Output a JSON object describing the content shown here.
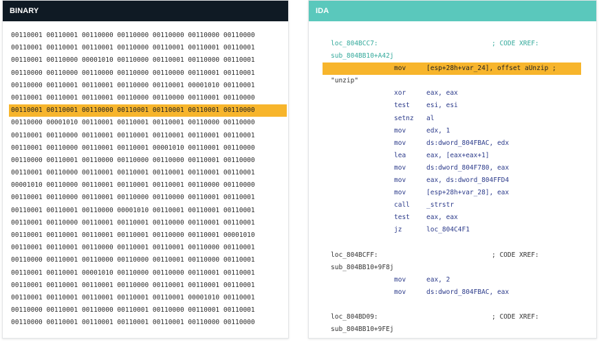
{
  "binary": {
    "title": "BINARY",
    "rows": [
      "00110001 00110001 00110000 00110000 00110000 00110000 00110000",
      "00110001 00110001 00110001 00110000 00110001 00110001 00110001",
      "00110001 00110000 00001010 00110000 00110001 00110000 00110001",
      "00110000 00110000 00110000 00110000 00110000 00110001 00110001",
      "00110000 00110001 00110001 00110000 00110001 00001010 00110001",
      "00110001 00110001 00110001 00110000 00110000 00110001 00110000",
      "00110001 00110001 00110000 00110001 00110001 00110001 00110000",
      "00110000 00001010 00110001 00110001 00110001 00110000 00110000",
      "00110001 00110000 00110001 00110001 00110001 00110001 00110001",
      "00110001 00110000 00110001 00110001 00001010 00110001 00110000",
      "00110000 00110001 00110000 00110000 00110000 00110001 00110000",
      "00110001 00110000 00110001 00110001 00110001 00110001 00110001",
      "00001010 00110000 00110001 00110001 00110001 00110000 00110000",
      "00110001 00110000 00110001 00110000 00110000 00110001 00110001",
      "00110001 00110001 00110000 00001010 00110001 00110001 00110001",
      "00110001 00110000 00110001 00110001 00110000 00110001 00110001",
      "00110001 00110001 00110001 00110001 00110000 00110001 00001010",
      "00110001 00110001 00110000 00110001 00110001 00110000 00110001",
      "00110000 00110001 00110000 00110000 00110001 00110000 00110001",
      "00110001 00110001 00001010 00110000 00110000 00110001 00110001",
      "00110001 00110001 00110001 00110000 00110001 00110001 00110001",
      "00110001 00110001 00110001 00110001 00110001 00001010 00110001",
      "00110000 00110001 00110000 00110001 00110000 00110001 00110001",
      "00110000 00110001 00110001 00110001 00110001 00110000 00110000"
    ],
    "highlighted_row": 6
  },
  "ida": {
    "title": "IDA",
    "lines": [
      {
        "label": "loc_804BCC7:",
        "xref": "; CODE XREF:"
      },
      {
        "label": "sub_804BB10+A42j"
      },
      {
        "mnemonic": "mov",
        "operand": "[esp+28h+var_24], offset aUnzip ;",
        "highlight": true
      },
      {
        "string": "\"unzip\""
      },
      {
        "mnemonic": "xor",
        "operand": "eax, eax"
      },
      {
        "mnemonic": "test",
        "operand": "esi, esi"
      },
      {
        "mnemonic": "setnz",
        "operand": "al"
      },
      {
        "mnemonic": "mov",
        "operand": "edx, 1"
      },
      {
        "mnemonic": "mov",
        "operand": "ds:dword_804FBAC, edx"
      },
      {
        "mnemonic": "lea",
        "operand": "eax, [eax+eax+1]"
      },
      {
        "mnemonic": "mov",
        "operand": "ds:dword_804F780, eax"
      },
      {
        "mnemonic": "mov",
        "operand": "eax, ds:dword_804FFD4"
      },
      {
        "mnemonic": "mov",
        "operand": "[esp+28h+var_28], eax"
      },
      {
        "mnemonic": "call",
        "operand": "_strstr"
      },
      {
        "mnemonic": "test",
        "operand": "eax, eax"
      },
      {
        "mnemonic": "jz",
        "operand": "loc_804C4F1"
      },
      {},
      {
        "label": "loc_804BCFF:",
        "xref": "; CODE XREF:",
        "dark": true
      },
      {
        "label": "sub_804BB10+9F8j",
        "dark": true
      },
      {
        "mnemonic": "mov",
        "operand": "eax, 2"
      },
      {
        "mnemonic": "mov",
        "operand": "ds:dword_804FBAC, eax"
      },
      {},
      {
        "label": "loc_804BD09:",
        "xref": "; CODE XREF:",
        "dark": true
      },
      {
        "label": "sub_804BB10+9FEj",
        "dark": true
      }
    ]
  },
  "colors": {
    "binary_header_bg": "#0f1a24",
    "ida_header_bg": "#5ac8bc",
    "highlight": "#f7b52c",
    "label_teal": "#33a99b",
    "mnemonic_navy": "#2b3a8a"
  }
}
